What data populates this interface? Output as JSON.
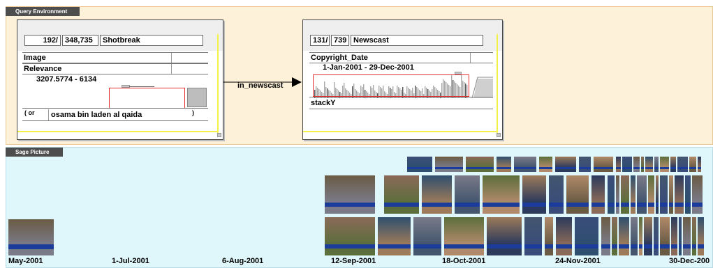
{
  "query_environment": {
    "title": "Query Environment",
    "left_box": {
      "count": "192/",
      "total": "348,735",
      "entity": "Shotbreak",
      "row1": "Image",
      "row2": "Relevance",
      "range": "3207.5774  -  6134",
      "search_prefix": "( or",
      "search_text": "osama bin laden al qaida",
      "search_suffix": ")"
    },
    "link_label": "in_newscast",
    "right_box": {
      "count": "131/",
      "total": "739",
      "entity": "Newscast",
      "row1": "Copyright_Date",
      "date_range": "1-Jan-2001  -  29-Dec-2001",
      "row2": "stackY"
    }
  },
  "sage_picture": {
    "title": "Sage Picture",
    "axis_labels": [
      "May-2001",
      "1-Jul-2001",
      "6-Aug-2001",
      "12-Sep-2001",
      "18-Oct-2001",
      "24-Nov-2001",
      "30-Dec-200"
    ]
  },
  "colors": {
    "query_bg": "#fdf1d9",
    "sage_bg": "#dff6fb",
    "red": "#e52d2d",
    "yellow": "#f4f24a"
  }
}
